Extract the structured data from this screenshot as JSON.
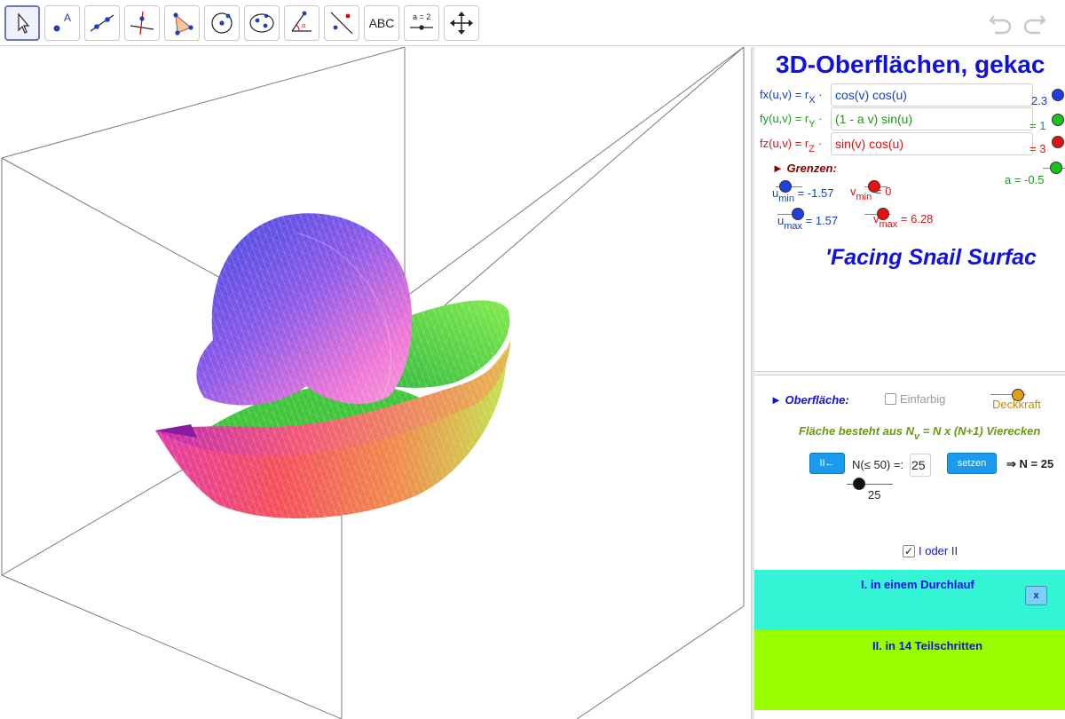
{
  "toolbar": {
    "tools": [
      {
        "name": "move-tool",
        "icon": "arrow-pointer-icon"
      },
      {
        "name": "point-tool",
        "icon": "point-icon",
        "label": "A"
      },
      {
        "name": "line-tool",
        "icon": "line-icon"
      },
      {
        "name": "perpendicular-tool",
        "icon": "perpendicular-icon"
      },
      {
        "name": "polygon-tool",
        "icon": "polygon-icon"
      },
      {
        "name": "circle-tool",
        "icon": "circle-icon"
      },
      {
        "name": "ellipse-tool",
        "icon": "ellipse-icon"
      },
      {
        "name": "angle-tool",
        "icon": "angle-icon"
      },
      {
        "name": "reflect-tool",
        "icon": "reflect-icon"
      },
      {
        "name": "text-tool",
        "icon": "text-icon",
        "label": "ABC"
      },
      {
        "name": "slider-tool",
        "icon": "slider-icon",
        "label": "a = 2"
      },
      {
        "name": "move-view-tool",
        "icon": "move-arrows-icon"
      }
    ],
    "undo_icon": "undo-icon",
    "redo_icon": "redo-icon"
  },
  "panel": {
    "title": "3D-Oberflächen, gekac",
    "fx_label": "fx(u,v) = r",
    "fx_sub": "X",
    "fx_value": "cos(v) cos(u)",
    "fy_label": "fy(u,v) = r",
    "fy_sub": "Y",
    "fy_value": "(1 - a v) sin(u)",
    "fz_label": "fz(u,v) = r",
    "fz_sub": "Z",
    "fz_value": "sin(v) cos(u)",
    "rx_value": "2.3",
    "ry_value": "= 1",
    "rz_value": "= 3",
    "grenzen": "Grenzen:",
    "umin_label": "u",
    "umin_sub": "min",
    "umin_value": "= -1.57",
    "vmin_label": "v",
    "vmin_sub": "min",
    "vmin_value": "= 0",
    "umax_label": "u",
    "umax_sub": "max",
    "umax_value": "= 1.57",
    "vmax_label": "v",
    "vmax_sub": "max",
    "vmax_value": "= 6.28",
    "a_value": "a = -0.5",
    "surface_name": "'Facing Snail Surfac",
    "oberflaeche": "Oberfläche:",
    "einfarbig": "Einfarbig",
    "einfarbig_checked": false,
    "deckkraft": "Deckkraft",
    "flaeche_text_1": "Fläche  besteht aus N",
    "flaeche_sub": "v",
    "flaeche_text_2": " = N x (N+1) Vierecken",
    "reset_button": "II←",
    "n_label": "N(≤ 50) =:",
    "n_value": "25",
    "setzen_button": "setzen",
    "n_result": "⇒ N = 25",
    "n_slider_value": "25",
    "n_slider_fraction": 0.5,
    "i_oder_ii": "I oder II",
    "i_oder_ii_checked": true,
    "section1_label": "I. in einem Durchlauf",
    "section1_close": "x",
    "section2_label": "II. in  14 Teilschritten"
  },
  "colors": {
    "title": "#1010e0",
    "blue": "#0f3fd0",
    "green": "#1a9a1a",
    "red": "#e01010",
    "dark_red": "#8b0000",
    "olive": "#6a9a10",
    "cyan": "#33f5d5",
    "lime": "#99ff00",
    "accent_button": "#1a9bf0"
  }
}
